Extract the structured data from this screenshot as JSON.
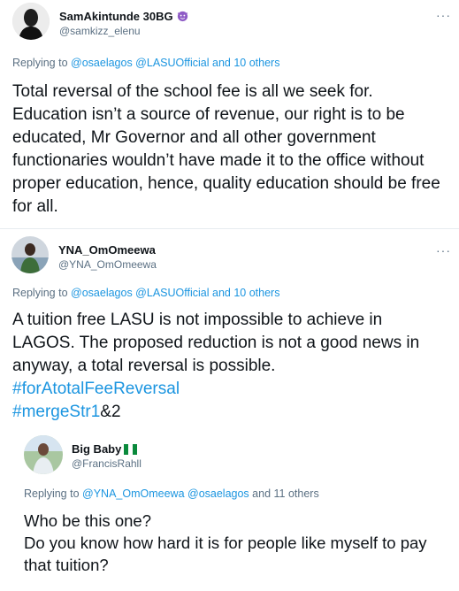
{
  "tweets": [
    {
      "display_name": "SamAkintunde 30BG",
      "handle": "@samkizz_elenu",
      "badge_icon": "smiling-devil-emoji",
      "more_label": "···",
      "replying_prefix": "Replying to",
      "replying_mentions": "@osaelagos @LASUOfficial",
      "replying_suffix": "and 10 others",
      "text": "Total reversal of the school fee is all we seek for. Education isn’t a source of revenue, our right is to be educated, Mr Governor and all other government functionaries wouldn’t have made it to the office without proper education, hence, quality education should be free for all."
    },
    {
      "display_name": "YNA_OmOmeewa",
      "handle": "@YNA_OmOmeewa",
      "more_label": "···",
      "replying_prefix": "Replying to",
      "replying_mentions": "@osaelagos @LASUOfficial",
      "replying_suffix": "and 10 others",
      "text": "A tuition free LASU is not impossible to achieve in LAGOS. The proposed reduction is not a good news in anyway, a total reversal is possible.",
      "hashtag1": "#forAtotalFeeReversal",
      "hashtag2": "#mergeStr1",
      "hashtag2_tail": "&2"
    },
    {
      "display_name": "Big Baby",
      "handle": "@FrancisRahll",
      "badge_icon": "nigeria-flag-emoji",
      "replying_prefix": "Replying to",
      "replying_mentions": "@YNA_OmOmeewa @osaelagos",
      "replying_suffix": "and 11 others",
      "text_line1": "Who be this one?",
      "text_line2": "Do you know how hard it is for people like myself to pay that tuition?"
    }
  ],
  "colors": {
    "link": "#1b95e0",
    "secondary_text": "#5b7083",
    "divider": "#e6ecf0"
  }
}
